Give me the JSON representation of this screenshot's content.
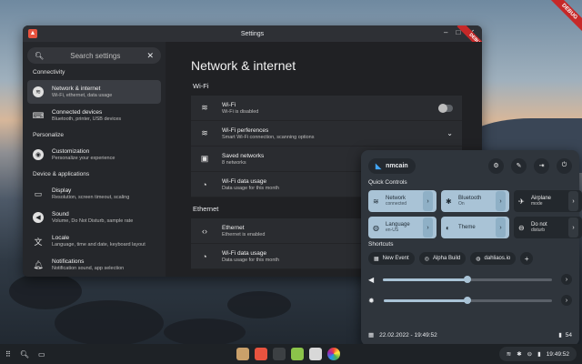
{
  "window": {
    "title": "Settings",
    "debug_badge": "DEBUG"
  },
  "corner_badge": "DEBUG",
  "sidebar": {
    "search_placeholder": "Search settings",
    "sections": [
      {
        "title": "Connectivity",
        "items": [
          {
            "label": "Network & internet",
            "desc": "Wi-Fi, ethernet, data usage",
            "icon": "wifi-icon",
            "active": true
          },
          {
            "label": "Connected devices",
            "desc": "Bluetooth, printer, USB devices",
            "icon": "devices-icon"
          }
        ]
      },
      {
        "title": "Personalize",
        "items": [
          {
            "label": "Customization",
            "desc": "Personalize your experience",
            "icon": "palette-icon"
          }
        ]
      },
      {
        "title": "Device & applications",
        "items": [
          {
            "label": "Display",
            "desc": "Resolution, screen timeout, scaling",
            "icon": "display-icon"
          },
          {
            "label": "Sound",
            "desc": "Volume, Do Not Disturb, sample rate",
            "icon": "volume-icon"
          },
          {
            "label": "Locale",
            "desc": "Language, time and date, keyboard layout",
            "icon": "translate-icon"
          },
          {
            "label": "Notifications",
            "desc": "Notification sound, app selection",
            "icon": "bell-icon"
          }
        ]
      }
    ]
  },
  "main": {
    "title": "Network & internet",
    "wifi_group": "Wi-Fi",
    "wifi_rows": [
      {
        "label": "Wi-Fi",
        "desc": "Wi-Fi is disabled"
      },
      {
        "label": "Wi-Fi perferences",
        "desc": "Smart Wi-Fi connection, scanning options"
      },
      {
        "label": "Saved networks",
        "desc": "8 networks"
      },
      {
        "label": "Wi-Fi data usage",
        "desc": "Data usage for this month"
      }
    ],
    "ethernet_group": "Ethernet",
    "ethernet_rows": [
      {
        "label": "Ethernet",
        "desc": "Ethernet is enabled"
      },
      {
        "label": "Wi-Fi data usage",
        "desc": "Data usage for this month"
      }
    ]
  },
  "quick": {
    "username": "nmcain",
    "quick_controls_title": "Quick Controls",
    "tiles": [
      {
        "label": "Network",
        "sub": "connected",
        "on": true
      },
      {
        "label": "Bluetooth",
        "sub": "On",
        "on": true
      },
      {
        "label": "Airplane",
        "sub": "mode",
        "on": false
      },
      {
        "label": "Language",
        "sub": "en-US",
        "on": true
      },
      {
        "label": "Theme",
        "sub": "",
        "on": true
      },
      {
        "label": "Do not",
        "sub": "disturb",
        "on": false
      }
    ],
    "shortcuts_title": "Shortcuts",
    "shortcuts": [
      "New Event",
      "Alpha Build",
      "dahliaos.io"
    ],
    "sliders": {
      "volume": 0.5,
      "brightness": 0.5
    },
    "datetime": "22.02.2022 - 19:49:52",
    "battery": "54"
  },
  "taskbar": {
    "clock": "19:49:52"
  }
}
